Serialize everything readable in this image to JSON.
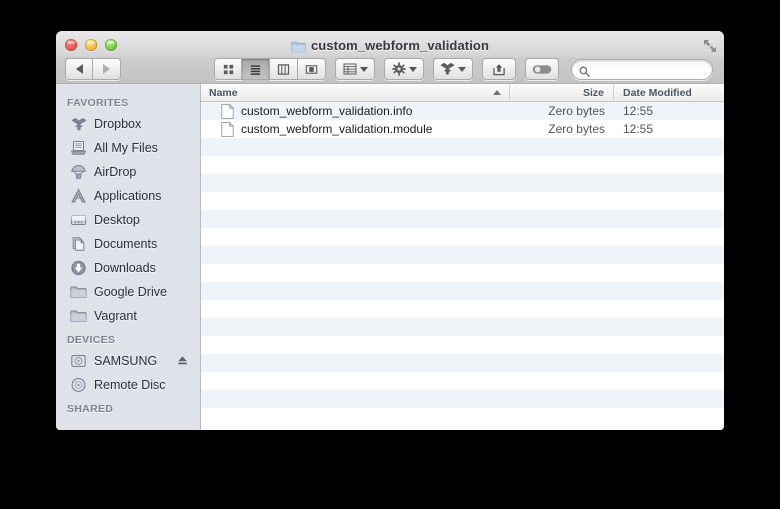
{
  "window": {
    "title": "custom_webform_validation",
    "title_icon": "folder-icon",
    "expand_icon": "fullscreen-expand-icon",
    "traffic_lights": [
      {
        "name": "close-button",
        "color": "#e4564b"
      },
      {
        "name": "minimize-button",
        "color": "#f2b63b"
      },
      {
        "name": "zoom-button",
        "color": "#72c940"
      }
    ]
  },
  "toolbar": {
    "back_icon": "back-arrow-icon",
    "forward_icon": "forward-arrow-icon",
    "views": [
      {
        "label": "",
        "icon": "icon-view-icon",
        "active": false
      },
      {
        "label": "",
        "icon": "list-view-icon",
        "active": true
      },
      {
        "label": "",
        "icon": "column-view-icon",
        "active": false
      },
      {
        "label": "",
        "icon": "coverflow-view-icon",
        "active": false
      }
    ],
    "arrange_icon": "arrange-by-icon",
    "action_icon": "gear-icon",
    "dropbox_icon": "dropbox-icon",
    "share_icon": "share-icon",
    "tag_icon": "tag-icon",
    "search": {
      "icon": "search-icon",
      "value": "",
      "placeholder": ""
    }
  },
  "sidebar": {
    "sections": [
      {
        "header": "FAVORITES",
        "items": [
          {
            "label": "Dropbox",
            "icon": "dropbox-icon",
            "eject": false
          },
          {
            "label": "All My Files",
            "icon": "all-my-files-icon",
            "eject": false
          },
          {
            "label": "AirDrop",
            "icon": "airdrop-icon",
            "eject": false
          },
          {
            "label": "Applications",
            "icon": "applications-icon",
            "eject": false
          },
          {
            "label": "Desktop",
            "icon": "desktop-icon",
            "eject": false
          },
          {
            "label": "Documents",
            "icon": "documents-icon",
            "eject": false
          },
          {
            "label": "Downloads",
            "icon": "downloads-icon",
            "eject": false
          },
          {
            "label": "Google Drive",
            "icon": "folder-icon",
            "eject": false
          },
          {
            "label": "Vagrant",
            "icon": "folder-icon",
            "eject": false
          }
        ]
      },
      {
        "header": "DEVICES",
        "items": [
          {
            "label": "SAMSUNG",
            "icon": "hard-disk-icon",
            "eject": true
          },
          {
            "label": "Remote Disc",
            "icon": "optical-disc-icon",
            "eject": false
          }
        ]
      },
      {
        "header": "SHARED",
        "items": []
      }
    ]
  },
  "file_list": {
    "columns": [
      {
        "label": "Name",
        "sorted": true,
        "sort_direction": "asc"
      },
      {
        "label": "Size",
        "sorted": false
      },
      {
        "label": "Date Modified",
        "sorted": false
      }
    ],
    "rows": [
      {
        "name": "custom_webform_validation.info",
        "icon": "document-icon",
        "size": "Zero bytes",
        "date": "12:55"
      },
      {
        "name": "custom_webform_validation.module",
        "icon": "document-icon",
        "size": "Zero bytes",
        "date": "12:55"
      }
    ],
    "empty_row_count": 16
  },
  "colors": {
    "stripe": "#eff3fa",
    "sidebar_bg": "#dfe3e9",
    "accent": "#4c5561"
  }
}
